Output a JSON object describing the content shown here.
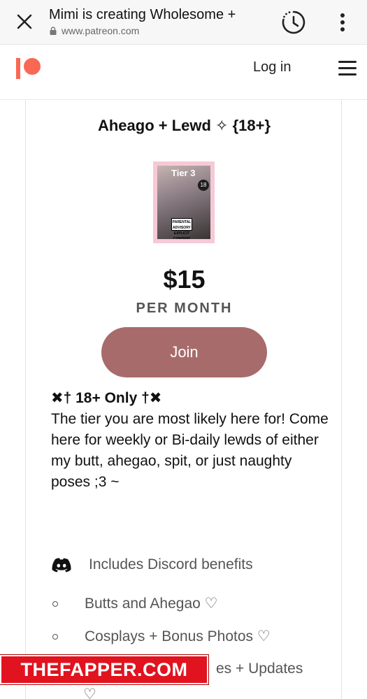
{
  "browser": {
    "page_title": "Mimi is creating Wholesome +",
    "url": "www.patreon.com"
  },
  "header": {
    "login_label": "Log in"
  },
  "tier": {
    "name": "Aheago + Lewd ✧ {18+}",
    "image": {
      "label": "Tier 3",
      "age_badge": "18",
      "advisory": "PARENTAL ADVISORY EXPLICIT CONTENT"
    },
    "price": "$15",
    "period": "PER MONTH",
    "join_label": "Join",
    "description_heading": "✖† 18+ Only †✖",
    "description": "The tier you are most likely here for! Come here for weekly or Bi-daily lewds of either my butt, ahegao, spit, or just naughty poses ;3 ~",
    "discord_benefit": "Includes Discord benefits",
    "benefits": [
      "Butts and Ahegao ♡",
      "Cosplays + Bonus Photos ♡",
      "es + Updates",
      "♡"
    ]
  },
  "watermark": "THEFAPPER.COM",
  "colors": {
    "join_button": "#a86b6b",
    "patreon_brand": "#f96854",
    "watermark_bg": "#e0131f"
  }
}
